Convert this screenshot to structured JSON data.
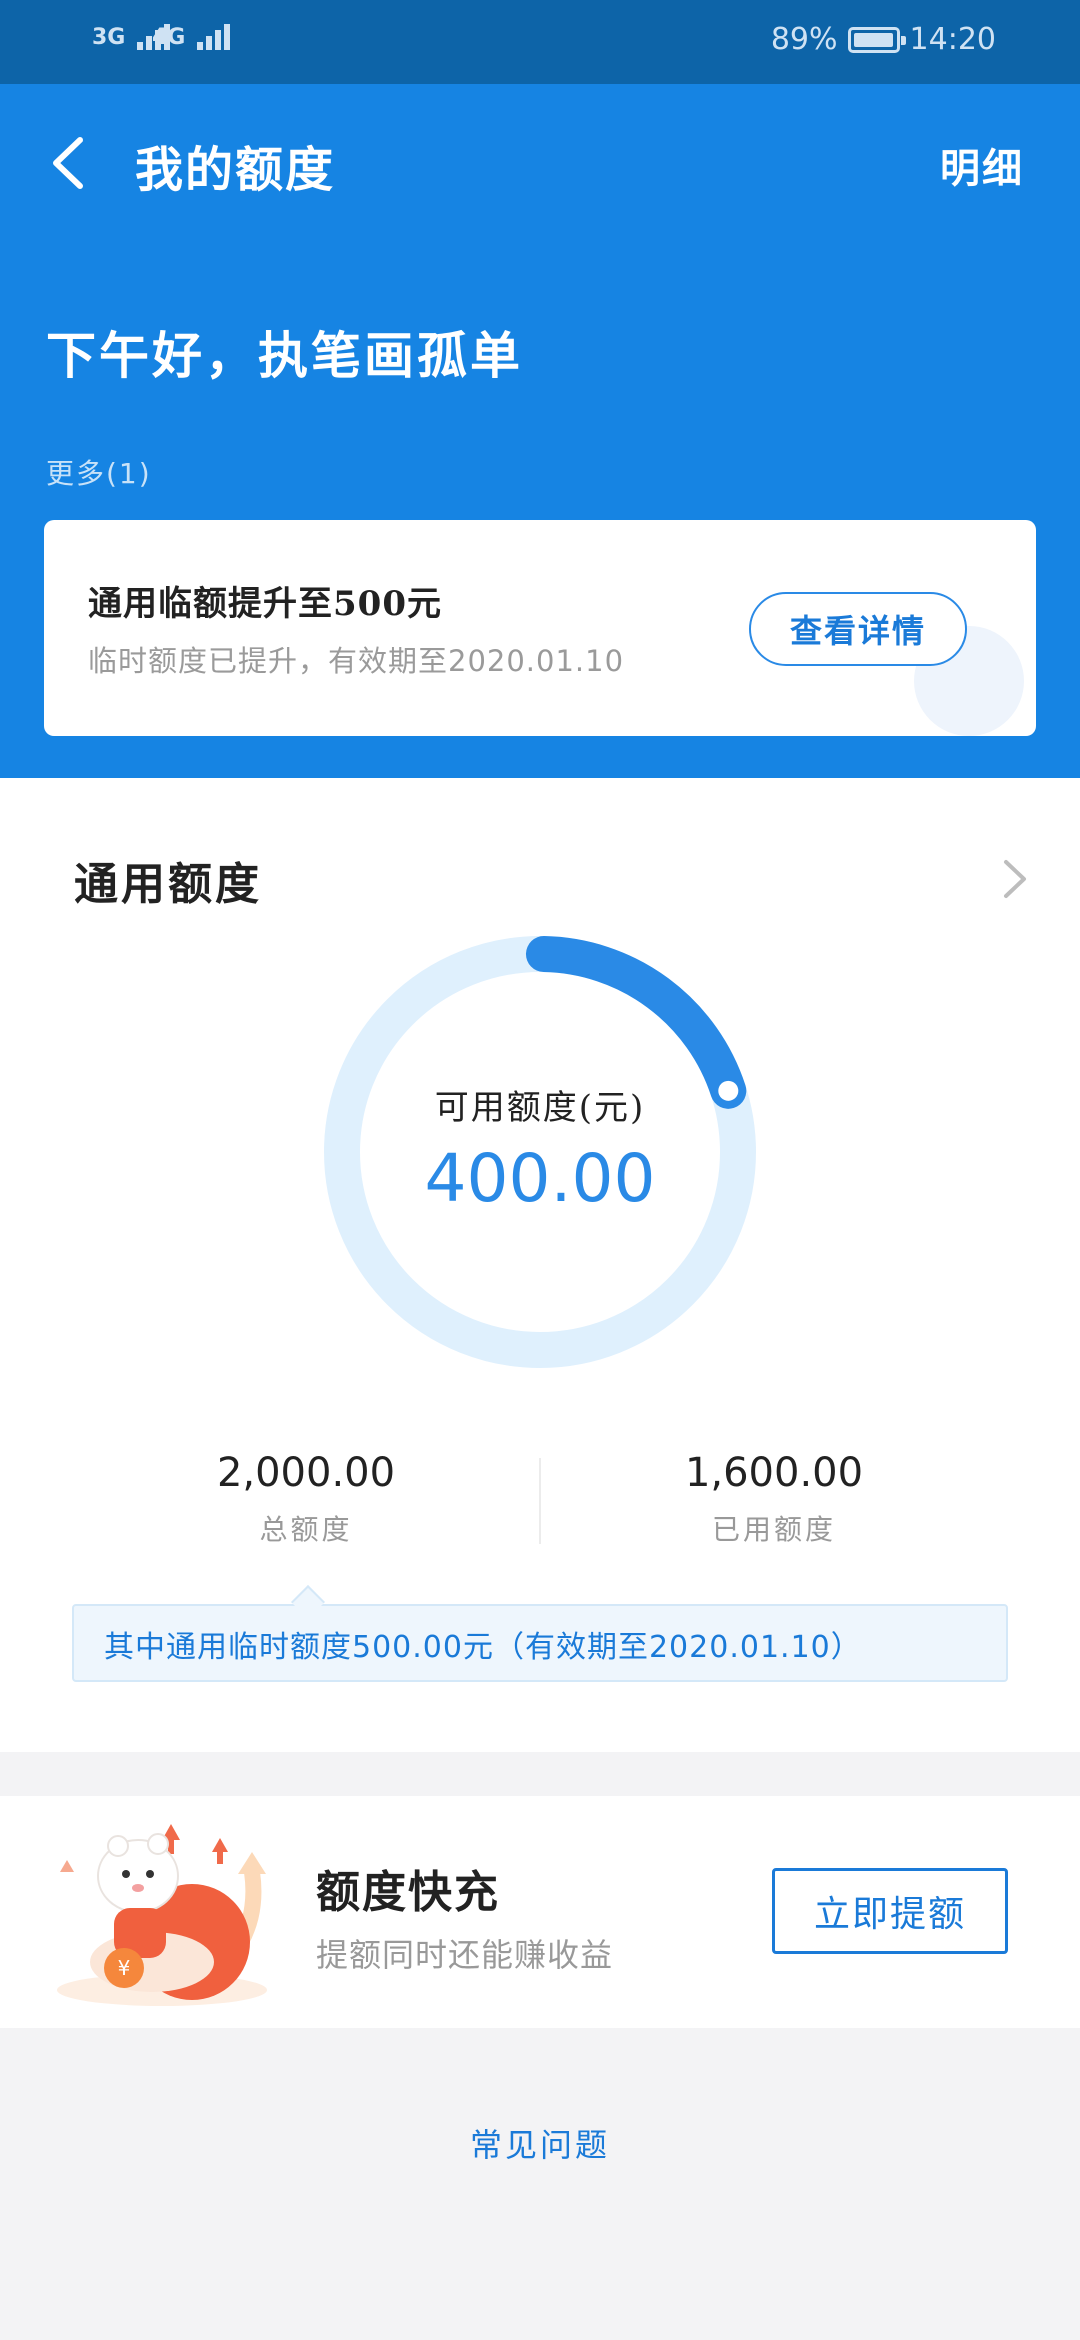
{
  "status_bar": {
    "signal_1_label": "3G",
    "signal_2_label": "4G",
    "battery_percent": "89%",
    "battery_level": 0.89,
    "time": "14:20"
  },
  "header": {
    "title": "我的额度",
    "detail_link": "明细",
    "greeting": "下午好，执笔画孤单",
    "more_link": "更多(1)"
  },
  "notice": {
    "title": "通用临额提升至500元",
    "subtitle": "临时额度已提升，有效期至2020.01.10",
    "button": "查看详情"
  },
  "credit": {
    "title": "通用额度",
    "available_label": "可用额度(元)",
    "available_value": "400.00",
    "available_fraction": 0.2,
    "total_value": "2,000.00",
    "total_label": "总额度",
    "used_value": "1,600.00",
    "used_label": "已用额度",
    "tip": "其中通用临时额度500.00元（有效期至2020.01.10）"
  },
  "promo": {
    "title": "额度快充",
    "subtitle": "提额同时还能赚收益",
    "button": "立即提额"
  },
  "faq": {
    "label": "常见问题"
  },
  "colors": {
    "header_blue": "#1684e3",
    "status_bar": "#0d64a8",
    "accent_blue": "#2a8ae6",
    "ring_track": "#dff0fd",
    "page_bg": "#f3f3f5"
  }
}
